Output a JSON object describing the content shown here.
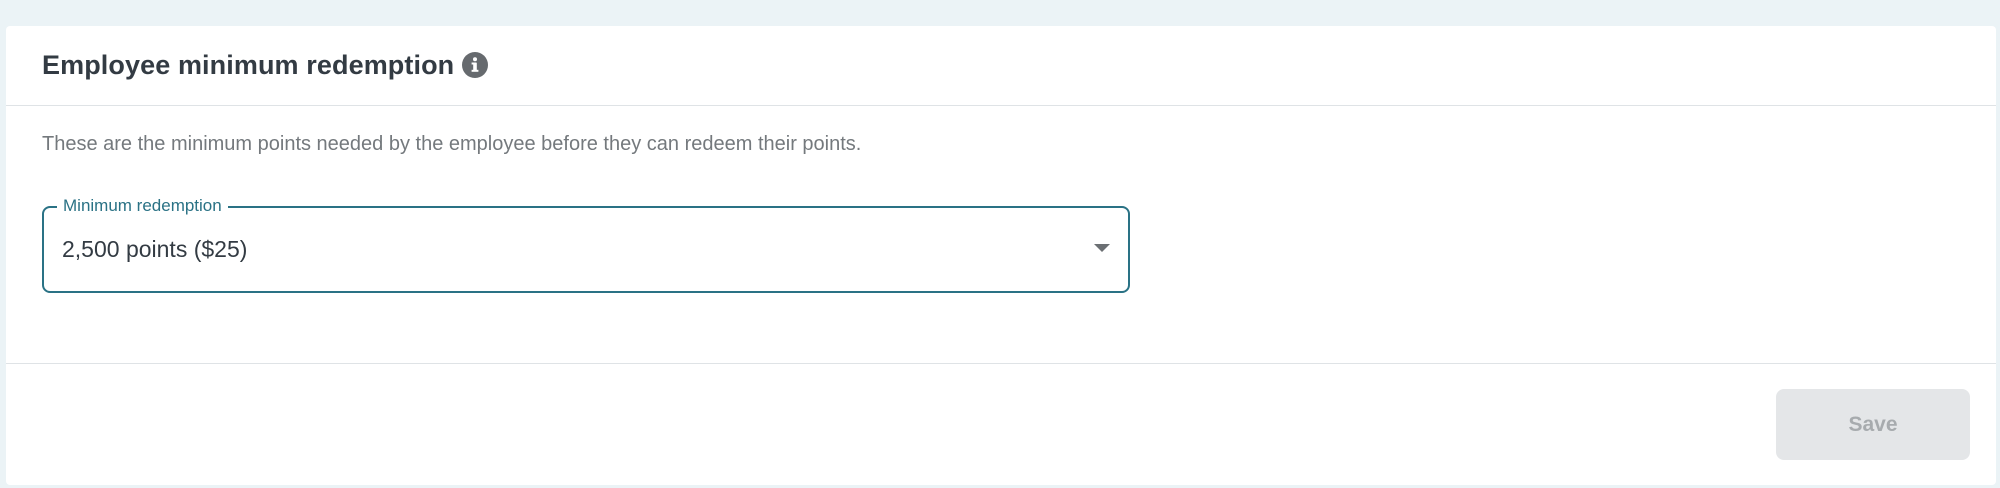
{
  "card": {
    "title": "Employee minimum redemption",
    "title_icon": "info-icon",
    "description": "These are the minimum points needed by the employee before they can redeem their points."
  },
  "minimum_redemption": {
    "label": "Minimum redemption",
    "selected_value": "2,500 points ($25)",
    "dropdown_icon": "caret-down-icon"
  },
  "footer": {
    "save_label": "Save",
    "save_enabled": false
  },
  "colors": {
    "page_background": "#ebf3f6",
    "card_background": "#ffffff",
    "accent": "#2a7285",
    "title_text": "#333b43",
    "muted_text": "#74797d",
    "disabled_button_bg": "#e4e6e8",
    "disabled_button_text": "#a7abae",
    "info_icon": "#666a6e"
  }
}
